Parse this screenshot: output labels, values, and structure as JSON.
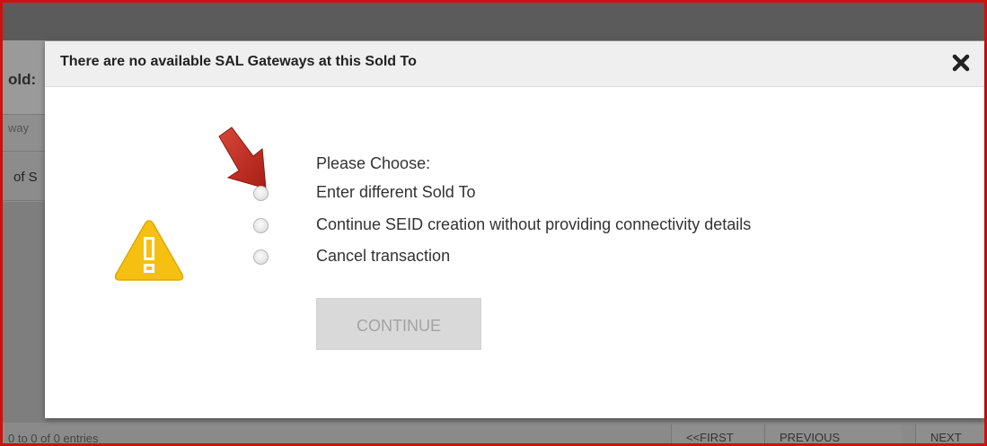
{
  "background": {
    "sold_label": "old:",
    "gateway_text": "way",
    "row_text": "of S",
    "entries_text": "0 to 0 of 0 entries",
    "pager": {
      "first": "<<FIRST",
      "previous": "PREVIOUS",
      "next": "NEXT"
    }
  },
  "modal": {
    "title": "There are no available SAL Gateways at this Sold To",
    "close_glyph": "✖",
    "prompt": "Please Choose:",
    "options": [
      {
        "label": "Enter different Sold To",
        "selected": false
      },
      {
        "label": "Continue SEID creation without providing connectivity details",
        "selected": false
      },
      {
        "label": "Cancel transaction",
        "selected": false
      }
    ],
    "continue_label": "CONTINUE",
    "icons": {
      "warning": "warning-triangle-icon",
      "arrow": "red-arrow-icon"
    }
  },
  "colors": {
    "frame_border": "#cc1111",
    "warning_fill": "#f5c012",
    "arrow_fill": "#c0281e",
    "button_disabled_bg": "#d9d9d9",
    "button_disabled_text": "#a3a3a3"
  }
}
